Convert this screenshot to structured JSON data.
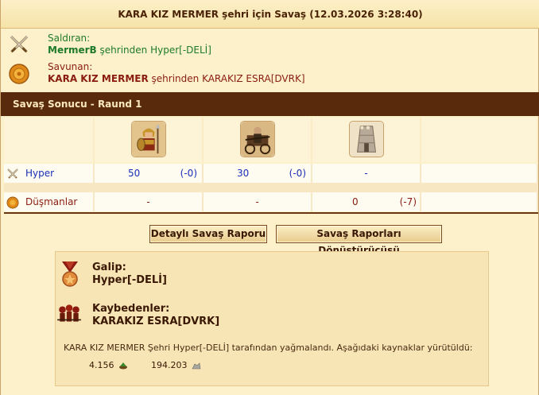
{
  "title": "KARA KIZ MERMER şehri için Savaş (12.03.2026 3:28:40)",
  "attacker": {
    "label": "Saldıran:",
    "city": "MermerB",
    "middle": " şehrinden ",
    "player": "Hyper[-DELİ]"
  },
  "defender": {
    "label": "Savunan:",
    "city": "KARA KIZ MERMER",
    "middle": " şehrinden ",
    "player": "KARAKIZ ESRA[DVRK]"
  },
  "result_header": "Savaş Sonucu - Raund 1",
  "units": [
    {
      "icon": "spearman-unit-icon"
    },
    {
      "icon": "archer-unit-icon"
    },
    {
      "icon": "wall-tower-icon"
    }
  ],
  "rows": {
    "hyper": {
      "name": "Hyper",
      "u1_count": "50",
      "u1_loss": "(-0)",
      "u2_count": "30",
      "u2_loss": "(-0)",
      "u3": "-"
    },
    "dusman": {
      "name": "Düşmanlar",
      "u1": "-",
      "u2": "-",
      "u3_count": "0",
      "u3_loss": "(-7)"
    }
  },
  "buttons": {
    "detail": "Detaylı Savaş Raporu",
    "converter": "Savaş Raporları Dönüştürücüsü"
  },
  "summary": {
    "winner_label": "Galip:",
    "winner": "Hyper[-DELİ]",
    "losers_label": "Kaybedenler:",
    "losers": "KARAKIZ ESRA[DVRK]",
    "description": "KARA KIZ MERMER Şehri Hyper[-DELİ] tarafından yağmalandı. Aşağıdaki kaynaklar yürütüldü:",
    "resource1": "4.156",
    "resource2": "194.203"
  },
  "colors": {
    "header_bar": "#5a2a0c",
    "attacker_text": "#1e7a2a",
    "defender_text": "#8a1c10",
    "ally_text": "#1a2fb8"
  }
}
